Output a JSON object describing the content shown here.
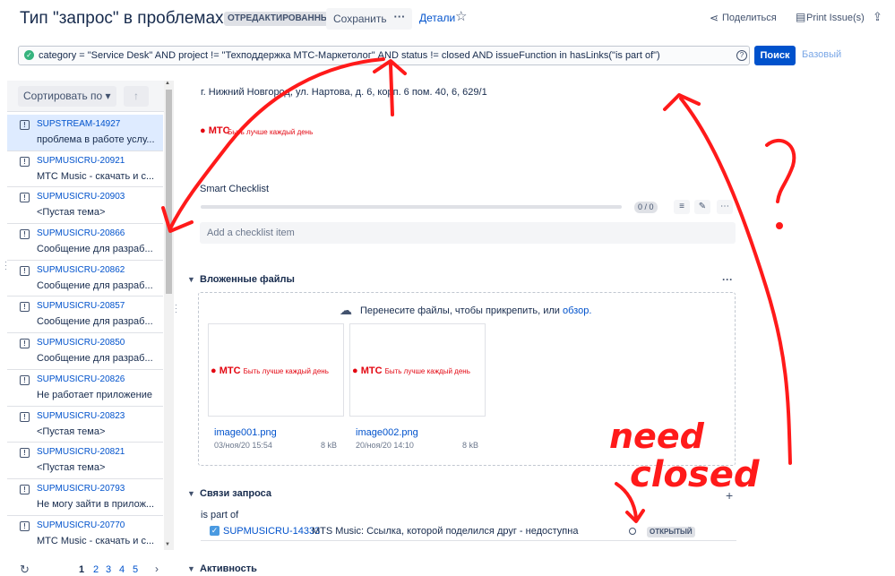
{
  "header": {
    "title": "Тип \"запрос\" в проблемах",
    "badge": "ОТРЕДАКТИРОВАННЫЙ",
    "save_label": "Сохранить",
    "more_label": "···",
    "details_label": "Детали",
    "share_label": "Поделиться",
    "print_label": "Print Issue(s)"
  },
  "jql": {
    "query": "category = \"Service Desk\" AND project != \"Техподдержка МТС-Маркетолог\" AND status != closed  AND issueFunction in hasLinks(\"is part of\")",
    "search_label": "Поиск",
    "basic_label": "Базовый"
  },
  "sidebar": {
    "sort_label": "Сортировать по",
    "items": [
      {
        "key": "SUPSTREAM-14927",
        "summary": "проблема в работе услу..."
      },
      {
        "key": "SUPMUSICRU-20921",
        "summary": "МТС Music - скачать и с..."
      },
      {
        "key": "SUPMUSICRU-20903",
        "summary": "<Пустая тема>"
      },
      {
        "key": "SUPMUSICRU-20866",
        "summary": "Сообщение для разраб..."
      },
      {
        "key": "SUPMUSICRU-20862",
        "summary": "Сообщение для разраб..."
      },
      {
        "key": "SUPMUSICRU-20857",
        "summary": "Сообщение для разраб..."
      },
      {
        "key": "SUPMUSICRU-20850",
        "summary": "Сообщение для разраб..."
      },
      {
        "key": "SUPMUSICRU-20826",
        "summary": "Не работает приложение"
      },
      {
        "key": "SUPMUSICRU-20823",
        "summary": "<Пустая тема>"
      },
      {
        "key": "SUPMUSICRU-20821",
        "summary": "<Пустая тема>"
      },
      {
        "key": "SUPMUSICRU-20793",
        "summary": "Не могу зайти в прилож..."
      },
      {
        "key": "SUPMUSICRU-20770",
        "summary": "МТС Music - скачать и с..."
      }
    ],
    "pages": [
      "1",
      "2",
      "3",
      "4",
      "5"
    ],
    "current_page": "1"
  },
  "details": {
    "address": "г. Нижний Новгород, ул. Нартова, д. 6, корп. 6 пом. 40, 6, 629/1",
    "mts_logo": "МТС",
    "mts_slogan": "Быть лучше каждый день"
  },
  "checklist": {
    "title": "Smart Checklist",
    "count": "0 / 0",
    "progress": 0,
    "add_placeholder": "Add a checklist item"
  },
  "attachments": {
    "title": "Вложенные файлы",
    "drop_text": "Перенесите файлы, чтобы прикрепить, или ",
    "drop_link": "обзор.",
    "files": [
      {
        "name": "image001.png",
        "date": "03/ноя/20 15:54",
        "size": "8 kB"
      },
      {
        "name": "image002.png",
        "date": "20/ноя/20 14:10",
        "size": "8 kB"
      }
    ]
  },
  "links": {
    "title": "Связи запроса",
    "type": "is part of",
    "items": [
      {
        "key": "SUPMUSICRU-14333",
        "summary": "MTS Music: Ссылка, которой поделился друг - недоступна",
        "status": "ОТКРЫТЫЙ"
      }
    ]
  },
  "activity": {
    "title": "Активность"
  },
  "annotations": {
    "text1": "need",
    "text2": "closed",
    "question": "?"
  },
  "colors": {
    "primary": "#0052cc",
    "annotation": "#ff1a1a",
    "mts_red": "#e30611"
  }
}
